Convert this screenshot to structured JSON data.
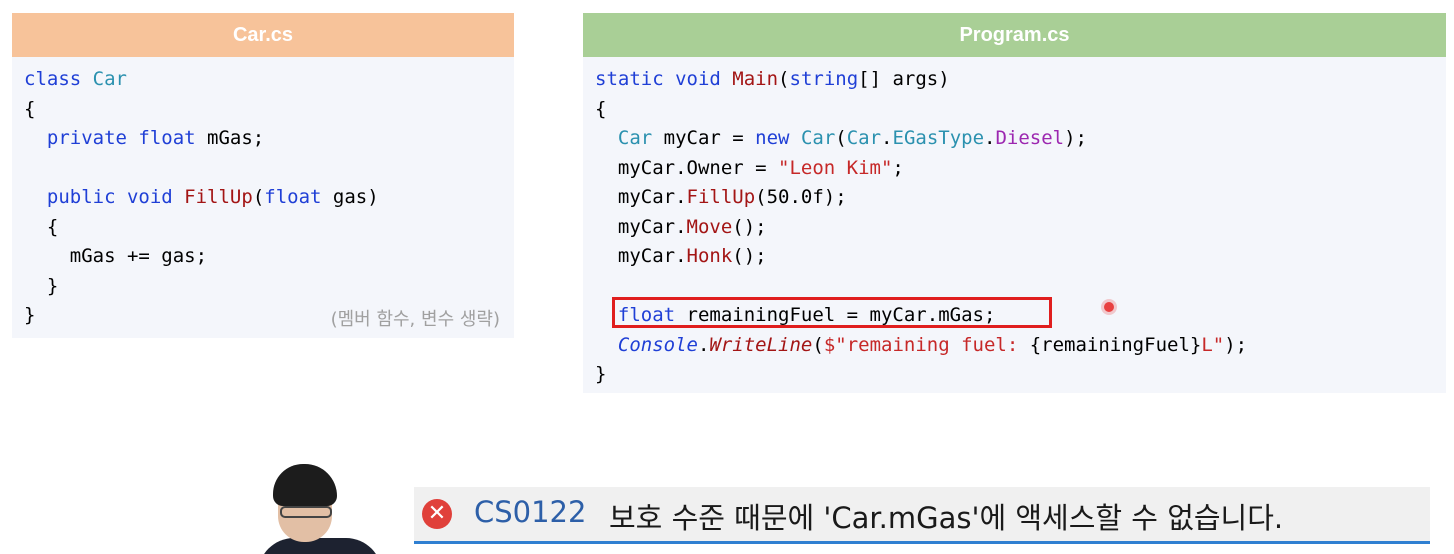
{
  "car_panel": {
    "title": "Car.cs",
    "lines": [
      [
        {
          "t": "class ",
          "c": "kw"
        },
        {
          "t": "Car",
          "c": "type"
        }
      ],
      [
        {
          "t": "{",
          "c": ""
        }
      ],
      [
        {
          "t": "  ",
          "c": ""
        },
        {
          "t": "private ",
          "c": "kw"
        },
        {
          "t": "float ",
          "c": "kw"
        },
        {
          "t": "mGas;",
          "c": ""
        }
      ],
      [
        {
          "t": "",
          "c": ""
        }
      ],
      [
        {
          "t": "  ",
          "c": ""
        },
        {
          "t": "public ",
          "c": "kw"
        },
        {
          "t": "void ",
          "c": "kw"
        },
        {
          "t": "FillUp",
          "c": "method"
        },
        {
          "t": "(",
          "c": ""
        },
        {
          "t": "float ",
          "c": "kw"
        },
        {
          "t": "gas)",
          "c": ""
        }
      ],
      [
        {
          "t": "  {",
          "c": ""
        }
      ],
      [
        {
          "t": "    mGas += gas;",
          "c": ""
        }
      ],
      [
        {
          "t": "  }",
          "c": ""
        }
      ],
      [
        {
          "t": "}",
          "c": ""
        }
      ]
    ],
    "note": "(멤버 함수, 변수 생략)"
  },
  "program_panel": {
    "title": "Program.cs",
    "lines": [
      [
        {
          "t": "static ",
          "c": "kw"
        },
        {
          "t": "void ",
          "c": "kw"
        },
        {
          "t": "Main",
          "c": "method"
        },
        {
          "t": "(",
          "c": ""
        },
        {
          "t": "string",
          "c": "kw"
        },
        {
          "t": "[] args)",
          "c": ""
        }
      ],
      [
        {
          "t": "{",
          "c": ""
        }
      ],
      [
        {
          "t": "  ",
          "c": ""
        },
        {
          "t": "Car",
          "c": "type"
        },
        {
          "t": " myCar = ",
          "c": ""
        },
        {
          "t": "new ",
          "c": "kw"
        },
        {
          "t": "Car",
          "c": "type"
        },
        {
          "t": "(",
          "c": ""
        },
        {
          "t": "Car",
          "c": "type"
        },
        {
          "t": ".",
          "c": ""
        },
        {
          "t": "EGasType",
          "c": "type"
        },
        {
          "t": ".",
          "c": ""
        },
        {
          "t": "Diesel",
          "c": "enum"
        },
        {
          "t": ");",
          "c": ""
        }
      ],
      [
        {
          "t": "  myCar.Owner = ",
          "c": ""
        },
        {
          "t": "\"Leon Kim\"",
          "c": "str"
        },
        {
          "t": ";",
          "c": ""
        }
      ],
      [
        {
          "t": "  myCar.",
          "c": ""
        },
        {
          "t": "FillUp",
          "c": "method"
        },
        {
          "t": "(50.0f);",
          "c": ""
        }
      ],
      [
        {
          "t": "  myCar.",
          "c": ""
        },
        {
          "t": "Move",
          "c": "method"
        },
        {
          "t": "();",
          "c": ""
        }
      ],
      [
        {
          "t": "  myCar.",
          "c": ""
        },
        {
          "t": "Honk",
          "c": "method"
        },
        {
          "t": "();",
          "c": ""
        }
      ],
      [
        {
          "t": "",
          "c": ""
        }
      ],
      [
        {
          "t": "  ",
          "c": ""
        },
        {
          "t": "float ",
          "c": "kw"
        },
        {
          "t": "remainingFuel = myCar.mGas;",
          "c": ""
        }
      ],
      [
        {
          "t": "  ",
          "c": ""
        },
        {
          "t": "Console",
          "c": "italic"
        },
        {
          "t": ".",
          "c": ""
        },
        {
          "t": "WriteLine",
          "c": "italic-m"
        },
        {
          "t": "(",
          "c": ""
        },
        {
          "t": "$\"remaining fuel: ",
          "c": "str"
        },
        {
          "t": "{remainingFuel}",
          "c": ""
        },
        {
          "t": "L\"",
          "c": "str"
        },
        {
          "t": ");",
          "c": ""
        }
      ],
      [
        {
          "t": "}",
          "c": ""
        }
      ]
    ]
  },
  "error": {
    "icon": "error-x-icon",
    "code": "CS0122",
    "message": "보호 수준 때문에 'Car.mGas'에 액세스할 수 없습니다."
  },
  "colors": {
    "car_header": "#f7c39a",
    "program_header": "#a9cf96",
    "highlight": "#e01e1e",
    "error_accent": "#2f7fd1"
  }
}
